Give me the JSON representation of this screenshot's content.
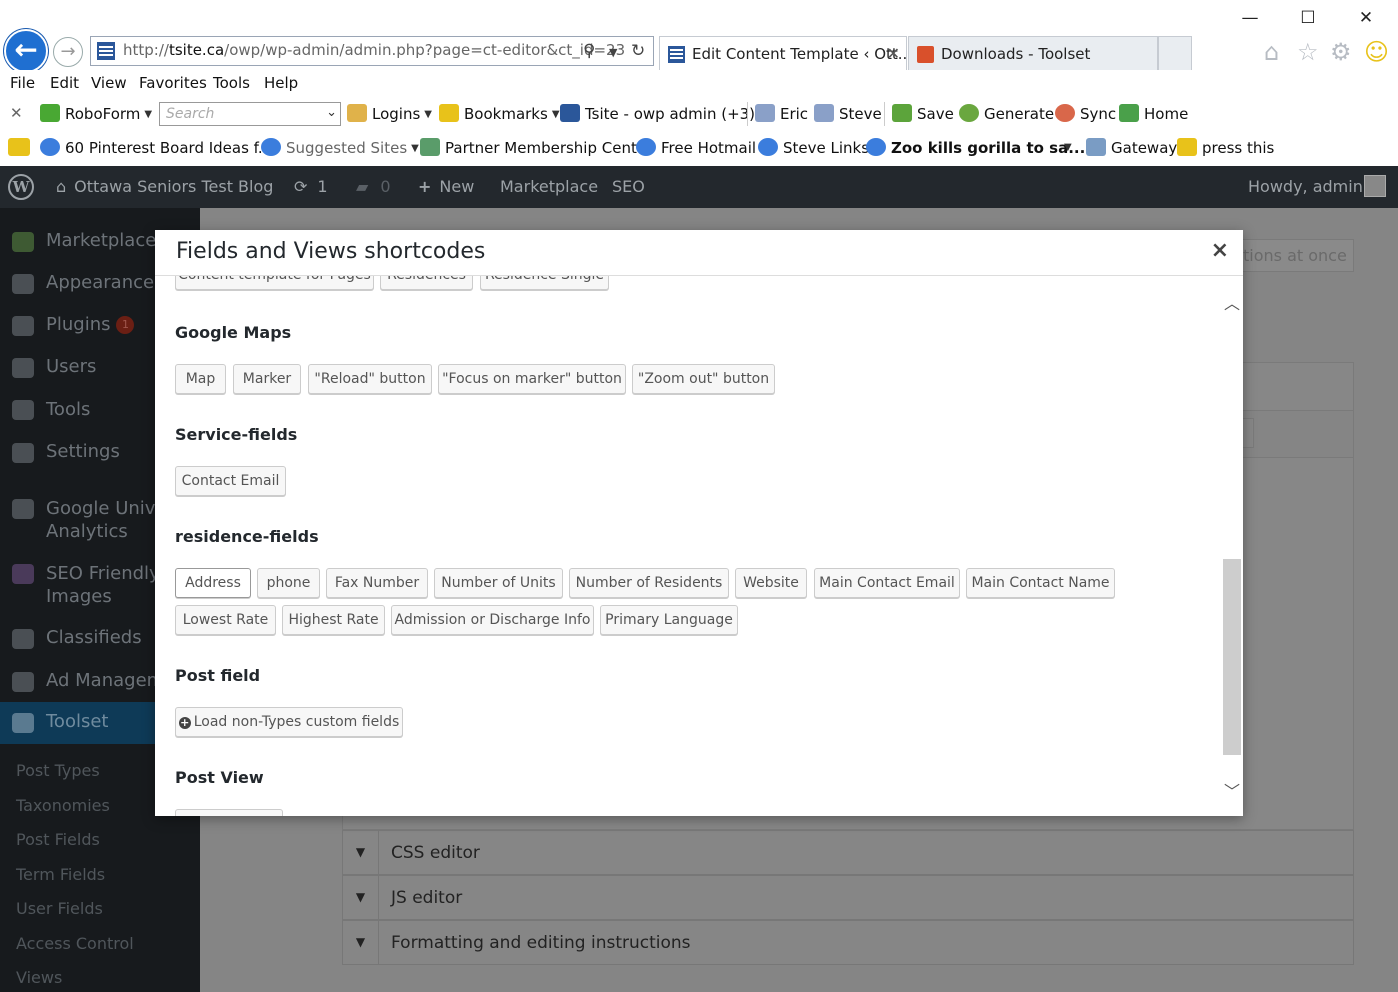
{
  "browser": {
    "address": "http://tsite.ca/owp/wp-admin/admin.php?page=ct-editor&ct_id=23",
    "address_host": "tsite.ca",
    "address_prefix": "http://",
    "address_rest": "/owp/wp-admin/admin.php?page=ct-editor&ct_id=23",
    "tabs": [
      {
        "title": "Edit Content Template ‹ Ott...",
        "active": true
      },
      {
        "title": "Downloads - Toolset",
        "active": false
      }
    ],
    "menu": [
      "File",
      "Edit",
      "View",
      "Favorites",
      "Tools",
      "Help"
    ],
    "toolbar": {
      "roboform": "RoboForm",
      "search_placeholder": "Search",
      "logins": "Logins",
      "bookmarks": "Bookmarks",
      "tsite": "Tsite - owp admin (+3)",
      "eric": "Eric",
      "steve": "Steve",
      "save": "Save",
      "generate": "Generate",
      "sync": "Sync",
      "home": "Home"
    },
    "favorites": [
      "60 Pinterest Board Ideas f...",
      "Suggested Sites",
      "Partner Membership Center",
      "Free Hotmail",
      "Steve Links",
      "Zoo kills gorilla to sa...",
      "Gateway",
      "press this"
    ]
  },
  "adminbar": {
    "site_name": "Ottawa Seniors Test Blog",
    "updates_count": "1",
    "comments_count": "0",
    "new_label": "New",
    "marketplace": "Marketplace",
    "seo": "SEO",
    "howdy": "Howdy, admin"
  },
  "sidebar": {
    "items": [
      {
        "label": "Marketplace"
      },
      {
        "label": "Appearance"
      },
      {
        "label": "Plugins",
        "badge": "1"
      },
      {
        "label": "Users"
      },
      {
        "label": "Tools"
      },
      {
        "label": "Settings"
      },
      {
        "label": "Google Unive",
        "label2": "Analytics"
      },
      {
        "label": "SEO Friendly",
        "label2": "Images"
      },
      {
        "label": "Classifieds"
      },
      {
        "label": "Ad Managem"
      },
      {
        "label": "Toolset"
      }
    ],
    "submenu": [
      "Post Types",
      "Taxonomies",
      "Post Fields",
      "Term Fields",
      "User Fields",
      "Access Control",
      "Views"
    ]
  },
  "background": {
    "top_right_button": "tions at once",
    "sections": [
      "CSS editor",
      "JS editor",
      "Formatting and editing instructions"
    ]
  },
  "modal": {
    "title": "Fields and Views shortcodes",
    "close": "×",
    "partial_row": [
      "Content template for Pages",
      "Residences",
      "Residence Single"
    ],
    "groups": [
      {
        "title": "Google Maps",
        "buttons": [
          "Map",
          "Marker",
          "\"Reload\" button",
          "\"Focus on marker\" button",
          "\"Zoom out\" button"
        ]
      },
      {
        "title": "Service-fields",
        "buttons": [
          "Contact Email"
        ]
      },
      {
        "title": "residence-fields",
        "buttons": [
          "Address",
          "phone",
          "Fax Number",
          "Number of Units",
          "Number of Residents",
          "Website",
          "Main Contact Email",
          "Main Contact Name",
          "Lowest Rate",
          "Highest Rate",
          "Admission or Discharge Info",
          "Primary Language"
        ]
      },
      {
        "title": "Post field",
        "buttons": [
          "Load non-Types custom fields"
        ]
      },
      {
        "title": "Post View",
        "buttons": []
      }
    ]
  }
}
